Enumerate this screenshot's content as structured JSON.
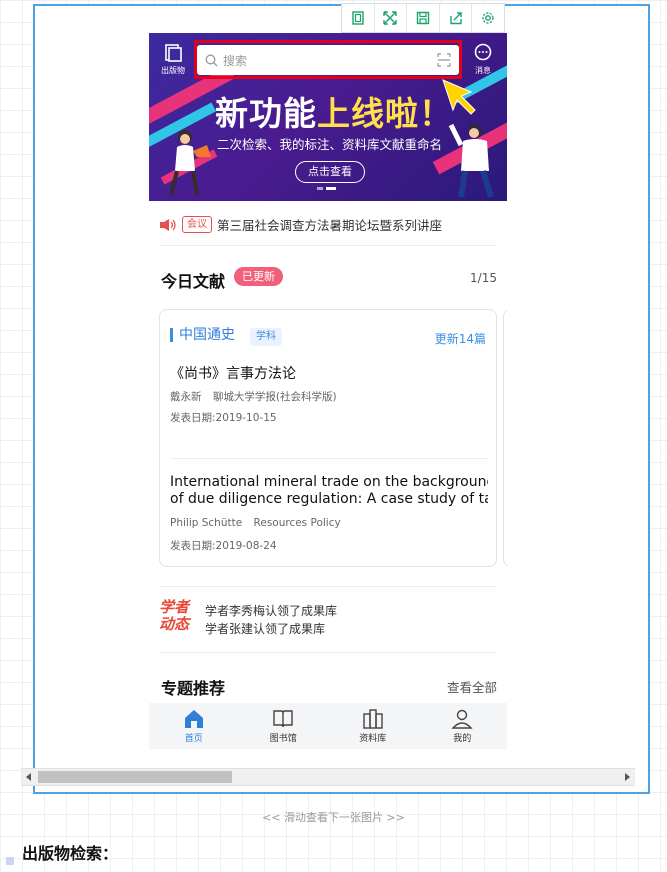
{
  "toolbar": {
    "icons": [
      "fit-page-icon",
      "expand-icon",
      "save-icon",
      "share-icon",
      "settings-icon"
    ]
  },
  "header": {
    "left_label": "出版物",
    "search_placeholder": "搜索",
    "right_label": "消息"
  },
  "banner": {
    "headline_part1": "新功能",
    "headline_part2": "上线啦！",
    "subline": "二次检索、我的标注、资料库文献重命名",
    "cta": "点击查看"
  },
  "notice": {
    "tag": "会议",
    "text": "第三届社会调查方法暑期论坛暨系列讲座"
  },
  "today": {
    "title": "今日文献",
    "badge": "已更新",
    "page": "1/15",
    "card": {
      "category": "中国通史",
      "subtag": "学科",
      "update": "更新14篇",
      "articles": [
        {
          "title": "《尚书》言事方法论",
          "authors": "戴永新",
          "journal": "聊城大学学报(社会科学版)",
          "date": "发表日期:2019-10-15"
        },
        {
          "title": "International mineral trade on the background",
          "title2": "of due diligence regulation: A case study of tant...",
          "authors": "Philip Schütte",
          "journal": "Resources Policy",
          "date": "发表日期:2019-08-24"
        }
      ]
    }
  },
  "scholar": {
    "logo_line1": "学者",
    "logo_line2": "动态",
    "items": [
      "学者李秀梅认领了成果库",
      "学者张建认领了成果库"
    ]
  },
  "topics": {
    "title": "专题推荐",
    "more": "查看全部"
  },
  "nav": [
    {
      "label": "首页",
      "icon": "home-icon"
    },
    {
      "label": "图书馆",
      "icon": "book-icon"
    },
    {
      "label": "资料库",
      "icon": "library-icon"
    },
    {
      "label": "我的",
      "icon": "user-icon"
    }
  ],
  "caption": "<<  滑动查看下一张图片  >>",
  "footer_title": "出版物检索："
}
